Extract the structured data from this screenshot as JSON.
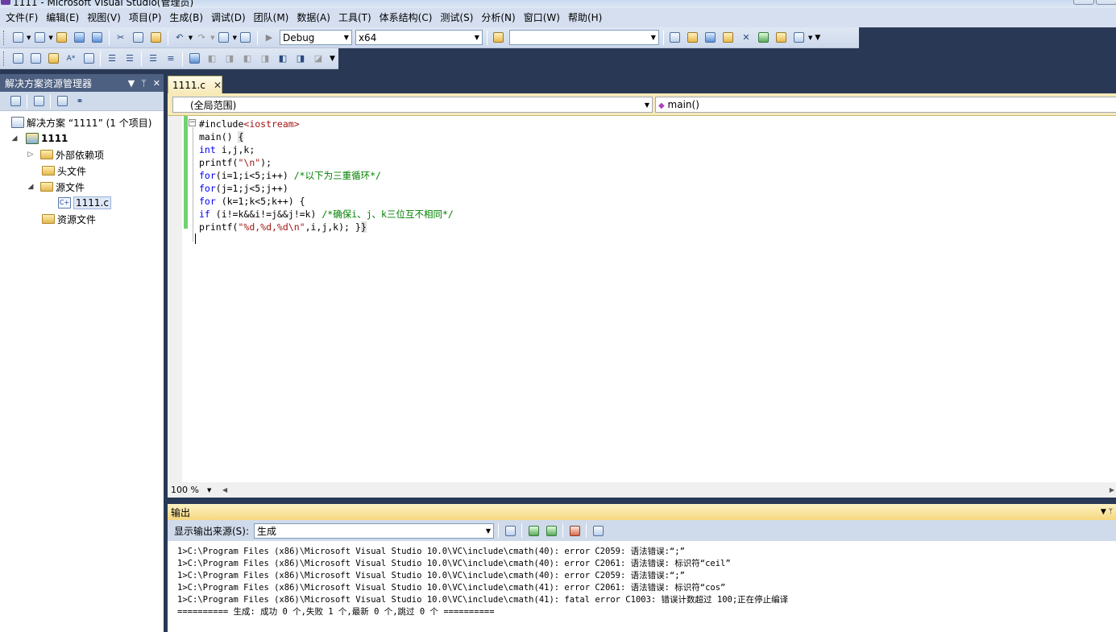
{
  "window": {
    "title": "1111 - Microsoft Visual Studio(管理员)"
  },
  "menu": [
    "文件(F)",
    "编辑(E)",
    "视图(V)",
    "项目(P)",
    "生成(B)",
    "调试(D)",
    "团队(M)",
    "数据(A)",
    "工具(T)",
    "体系结构(C)",
    "测试(S)",
    "分析(N)",
    "窗口(W)",
    "帮助(H)"
  ],
  "toolbar": {
    "config": "Debug",
    "platform": "x64",
    "find_value": ""
  },
  "solution_explorer": {
    "title": "解决方案资源管理器",
    "solution_label": "解决方案 “1111” (1 个项目)",
    "project": "1111",
    "external_deps": "外部依赖项",
    "headers": "头文件",
    "sources": "源文件",
    "file": "1111.c",
    "resources": "资源文件"
  },
  "editor": {
    "tab": "1111.c",
    "scope": "(全局范围)",
    "member": "main()",
    "zoom": "100 %",
    "lines": [
      [
        {
          "t": "#include",
          "c": ""
        },
        {
          "t": "<iostream>",
          "c": "str"
        }
      ],
      [
        {
          "t": "main() ",
          "c": ""
        },
        {
          "t": "{",
          "c": "br"
        }
      ],
      [
        {
          "t": "int",
          "c": "kw"
        },
        {
          "t": " i,j,k;",
          "c": ""
        }
      ],
      [
        {
          "t": "printf(",
          "c": ""
        },
        {
          "t": "\"\\n\"",
          "c": "str"
        },
        {
          "t": ");",
          "c": ""
        }
      ],
      [
        {
          "t": "for",
          "c": "kw"
        },
        {
          "t": "(i=1;i<5;i++) ",
          "c": ""
        },
        {
          "t": "/*以下为三重循环*/",
          "c": "cm"
        }
      ],
      [
        {
          "t": "for",
          "c": "kw"
        },
        {
          "t": "(j=1;j<5;j++)",
          "c": ""
        }
      ],
      [
        {
          "t": "for",
          "c": "kw"
        },
        {
          "t": " (k=1;k<5;k++) {",
          "c": ""
        }
      ],
      [
        {
          "t": "if",
          "c": "kw"
        },
        {
          "t": " (i!=k&&i!=j&&j!=k) ",
          "c": ""
        },
        {
          "t": "/*确保i、j、k三位互不相同*/",
          "c": "cm"
        }
      ],
      [
        {
          "t": "printf(",
          "c": ""
        },
        {
          "t": "\"%d,%d,%d\\n\"",
          "c": "str"
        },
        {
          "t": ",i,j,k); }",
          "c": ""
        },
        {
          "t": "}",
          "c": "br"
        }
      ]
    ]
  },
  "output": {
    "title": "输出",
    "source_label": "显示输出来源(S):",
    "source_value": "生成",
    "lines": [
      "1>C:\\Program Files (x86)\\Microsoft Visual Studio 10.0\\VC\\include\\cmath(40): error C2059: 语法错误:“;”",
      "1>C:\\Program Files (x86)\\Microsoft Visual Studio 10.0\\VC\\include\\cmath(40): error C2061: 语法错误: 标识符“ceil”",
      "1>C:\\Program Files (x86)\\Microsoft Visual Studio 10.0\\VC\\include\\cmath(40): error C2059: 语法错误:“;”",
      "1>C:\\Program Files (x86)\\Microsoft Visual Studio 10.0\\VC\\include\\cmath(41): error C2061: 语法错误: 标识符“cos”",
      "1>C:\\Program Files (x86)\\Microsoft Visual Studio 10.0\\VC\\include\\cmath(41): fatal error C1003: 错误计数超过 100;正在停止编译",
      "========== 生成: 成功 0 个,失败 1 个,最新 0 个,跳过 0 个 =========="
    ]
  }
}
